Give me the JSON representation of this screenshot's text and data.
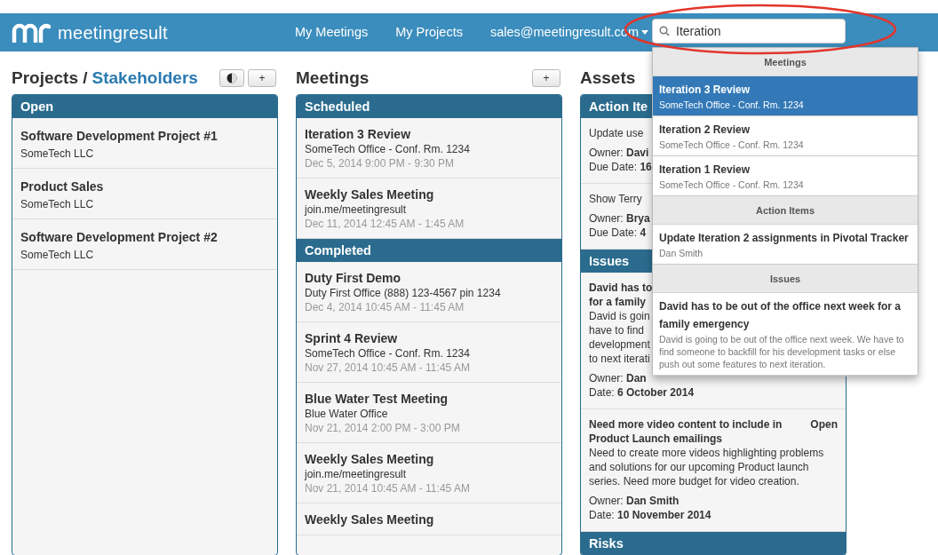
{
  "header": {
    "logo": "meetingresult",
    "nav": [
      "My Meetings",
      "My Projects"
    ],
    "account": "sales@meetingresult.com",
    "search": {
      "value": "Iteration"
    }
  },
  "annotation": {
    "kind": "ellipse"
  },
  "projects": {
    "title": "Projects /",
    "title_link": "Stakeholders",
    "buttons": [
      {
        "kind": "toggle"
      },
      {
        "kind": "add",
        "label": "+"
      }
    ],
    "sections": [
      {
        "label": "Open",
        "items": [
          {
            "title": "Software Development Project #1",
            "subtitle": "SomeTech LLC"
          },
          {
            "title": "Product Sales",
            "subtitle": "SomeTech LLC"
          },
          {
            "title": "Software Development Project #2",
            "subtitle": "SomeTech LLC"
          }
        ]
      }
    ]
  },
  "meetings": {
    "title": "Meetings",
    "buttons": [
      {
        "kind": "add",
        "label": "+"
      }
    ],
    "sections": [
      {
        "label": "Scheduled",
        "items": [
          {
            "title": "Iteration 3 Review",
            "location": "SomeTech Office - Conf. Rm. 1234",
            "time": "Dec 5, 2014 9:00 PM - 9:30 PM"
          },
          {
            "title": "Weekly Sales Meeting",
            "location": "join.me/meetingresult",
            "time": "Dec 11, 2014 12:45 AM - 1:45 AM"
          }
        ]
      },
      {
        "label": "Completed",
        "items": [
          {
            "title": "Duty First Demo",
            "location": "Duty First Office (888) 123-4567 pin 1234",
            "time": "Dec 4, 2014 10:45 AM - 11:45 AM"
          },
          {
            "title": "Sprint 4 Review",
            "location": "SomeTech Office - Conf. Rm. 1234",
            "time": "Nov 27, 2014 10:45 AM - 11:45 AM"
          },
          {
            "title": "Blue Water Test Meeting",
            "location": "Blue Water Office",
            "time": "Nov 21, 2014 2:00 PM - 3:00 PM"
          },
          {
            "title": "Weekly Sales Meeting",
            "location": "join.me/meetingresult",
            "time": "Nov 21, 2014 10:45 AM - 11:45 AM"
          },
          {
            "title": "Weekly Sales Meeting"
          }
        ]
      }
    ]
  },
  "assets": {
    "title": "Assets",
    "sections": [
      {
        "label": "Action Ite",
        "items": [
          {
            "body": [
              "Update use"
            ],
            "meta": [
              "Owner: **Davi**",
              "Due Date: **16**"
            ]
          },
          {
            "body": [
              "Show Terry"
            ],
            "meta": [
              "Owner: **Brya**",
              "Due Date: **4**"
            ]
          }
        ]
      },
      {
        "label": "Issues",
        "items": [
          {
            "title": [
              "David has to",
              "for a family"
            ],
            "body": [
              "David is goin",
              "have to find",
              "development",
              "to next iterati"
            ],
            "meta": [
              "Owner: **Dan**",
              "Date: **6 October 2014**"
            ]
          },
          {
            "title": [
              "Need more video content to include in",
              "Product Launch emailings"
            ],
            "status": "Open",
            "body": [
              "Need to create more videos highlighting problems",
              "and solutions for our upcoming Product launch",
              "series.  Need more budget for video creation."
            ],
            "meta": [
              "Owner: **Dan Smith**",
              "Date: **10 November 2014**"
            ]
          }
        ]
      },
      {
        "label": "Risks"
      }
    ]
  },
  "search_results": [
    {
      "kind": "header",
      "label": "Meetings"
    },
    {
      "kind": "result",
      "title": "Iteration 3 Review",
      "subtitle": "SomeTech Office - Conf. Rm. 1234",
      "selected": true
    },
    {
      "kind": "result",
      "title": "Iteration 2 Review",
      "subtitle": "SomeTech Office - Conf. Rm. 1234",
      "selected": false
    },
    {
      "kind": "result",
      "title": "Iteration 1 Review",
      "subtitle": "SomeTech Office - Conf. Rm. 1234",
      "selected": false
    },
    {
      "kind": "header",
      "label": "Action Items"
    },
    {
      "kind": "result",
      "title": "Update Iteration 2 assignments in Pivotal Tracker",
      "subtitle": "Dan Smith",
      "selected": false
    },
    {
      "kind": "header",
      "label": "Issues"
    },
    {
      "kind": "result",
      "title": "David has to be out of the office next week for a family emergency",
      "subtitle": "David is going to be out of the office next week.  We have to find someone to backfill for his development tasks or else push out some features to next iteration.",
      "selected": false
    }
  ]
}
